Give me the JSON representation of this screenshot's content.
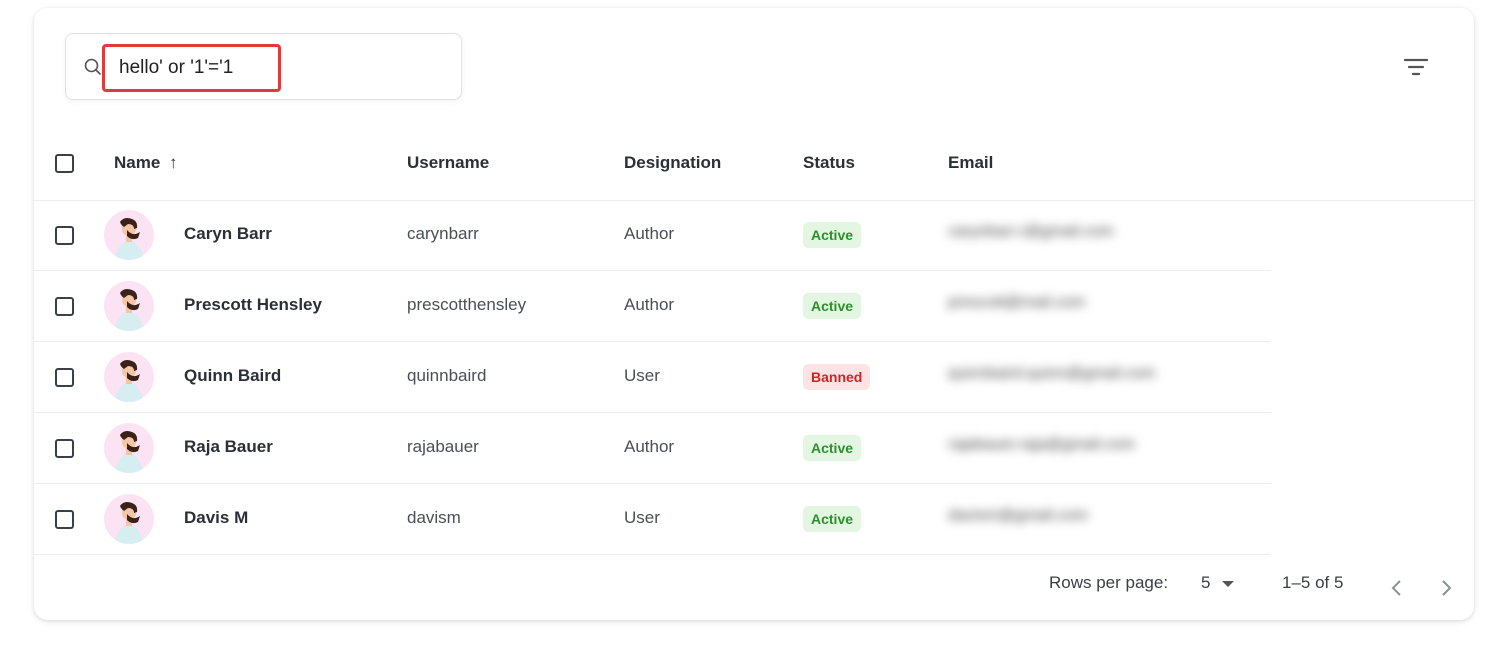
{
  "search": {
    "value": "hello' or '1'='1",
    "icon": "search-icon"
  },
  "toolbar": {
    "filter_icon": "filter-icon"
  },
  "table": {
    "columns": {
      "name": "Name",
      "username": "Username",
      "designation": "Designation",
      "status": "Status",
      "email": "Email"
    },
    "sort_indicator": "↑",
    "rows": [
      {
        "name": "Caryn Barr",
        "username": "carynbarr",
        "designation": "Author",
        "status": "Active",
        "email": "carynbarr.r@gmail.com"
      },
      {
        "name": "Prescott Hensley",
        "username": "prescotthensley",
        "designation": "Author",
        "status": "Active",
        "email": "prescott@mail.com"
      },
      {
        "name": "Quinn Baird",
        "username": "quinnbaird",
        "designation": "User",
        "status": "Banned",
        "email": "quinnbaird.quinn@gmail.com"
      },
      {
        "name": "Raja Bauer",
        "username": "rajabauer",
        "designation": "Author",
        "status": "Active",
        "email": "rajabauer.raja@gmail.com"
      },
      {
        "name": "Davis M",
        "username": "davism",
        "designation": "User",
        "status": "Active",
        "email": "davism@gmail.com"
      }
    ]
  },
  "pagination": {
    "rows_per_page_label": "Rows per page:",
    "rows_per_page_value": "5",
    "range": "1–5 of 5"
  },
  "colors": {
    "active_bg": "#e3f6e1",
    "active_text": "#2f8f2c",
    "banned_bg": "#fde3e3",
    "banned_text": "#c62828",
    "highlight": "#e03a3a"
  }
}
